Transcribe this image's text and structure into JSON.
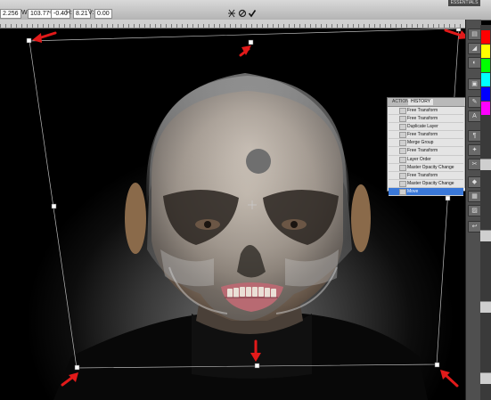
{
  "options_bar": {
    "field_1": "2.256",
    "w_label": "W:",
    "w_value": "103.77%",
    "angle_value": "-0.40",
    "h_label": "H:",
    "h_value": "8.21",
    "v_label": "V:",
    "v_value": "0.00",
    "workspace_label": "ESSENTIALS",
    "warp_icon": "warp-icon",
    "cancel_icon": "cancel-icon",
    "commit_icon": "checkmark-icon"
  },
  "history_panel": {
    "tabs": [
      "ACTIONS",
      "HISTORY"
    ],
    "active_tab": "HISTORY",
    "items": [
      "Free Transform",
      "Free Transform",
      "Duplicate Layer",
      "Free Transform",
      "Merge Group",
      "Free Transform",
      "Layer Order",
      "Master Opacity Change",
      "Free Transform",
      "Master Opacity Change",
      "Move"
    ],
    "selected_item": "Move"
  },
  "colors": {
    "annotation_arrow": "#e21a1a",
    "selection": "#3a78d8",
    "swatches": [
      "#ff0000",
      "#ffff00",
      "#00ff00",
      "#00ffff",
      "#0000ff",
      "#ff00ff"
    ]
  },
  "annotation": "red arrows pointing at transform handles"
}
